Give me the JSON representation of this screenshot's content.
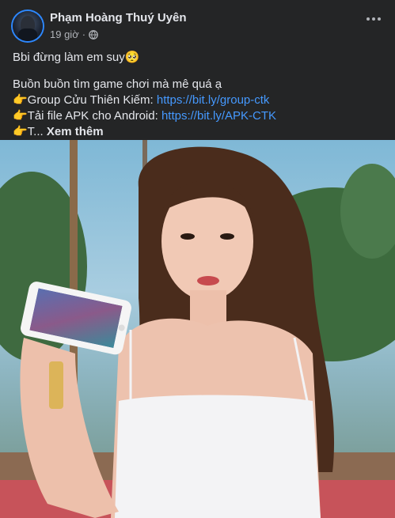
{
  "post": {
    "author": "Phạm Hoàng Thuý Uyên",
    "time": "19 giờ",
    "dot": "·",
    "lines": {
      "line1": "Bbi đừng làm em suy",
      "line1_emoji": "🥺",
      "line2": "Buồn buồn tìm game chơi mà mê quá ạ",
      "line3_prefix": "👉Group Cửu Thiên Kiếm: ",
      "line3_link": "https://bit.ly/group-ctk",
      "line4_prefix": "👉Tải file APK cho Android: ",
      "line4_link": "https://bit.ly/APK-CTK",
      "line5_prefix": "👉T... ",
      "see_more": "Xem thêm"
    },
    "icons": {
      "privacy": "globe-icon",
      "options": "more-options-icon"
    },
    "colors": {
      "background": "#242526",
      "text": "#e4e6eb",
      "secondary_text": "#b0b3b8",
      "link": "#4599ff"
    }
  }
}
